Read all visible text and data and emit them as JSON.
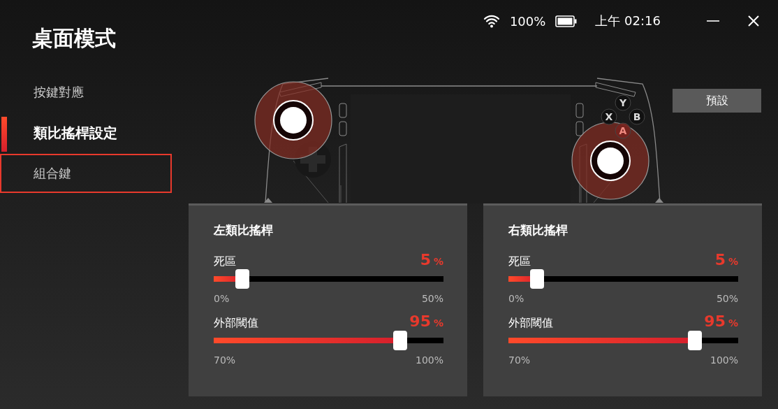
{
  "page_title": "桌面模式",
  "nav": [
    {
      "label": "按鍵對應",
      "selected": false,
      "focused": false
    },
    {
      "label": "類比搖桿設定",
      "selected": true,
      "focused": false
    },
    {
      "label": "組合鍵",
      "selected": false,
      "focused": true
    }
  ],
  "status_bar": {
    "battery": "100%",
    "time": "上午 02:16"
  },
  "face_buttons": [
    "Y",
    "X",
    "B",
    "A"
  ],
  "preset_button": "預設",
  "panels": [
    {
      "title": "左類比搖桿",
      "settings": [
        {
          "label": "死區",
          "value": "5",
          "unit": "%",
          "level": 0.1,
          "min": "0%",
          "max": "50%"
        },
        {
          "label": "外部閾值",
          "value": "95",
          "unit": "%",
          "level": 0.833,
          "min": "70%",
          "max": "100%"
        }
      ]
    },
    {
      "title": "右類比搖桿",
      "settings": [
        {
          "label": "死區",
          "value": "5",
          "unit": "%",
          "level": 0.1,
          "min": "0%",
          "max": "50%"
        },
        {
          "label": "外部閾值",
          "value": "95",
          "unit": "%",
          "level": 0.833,
          "min": "70%",
          "max": "100%"
        }
      ]
    }
  ]
}
